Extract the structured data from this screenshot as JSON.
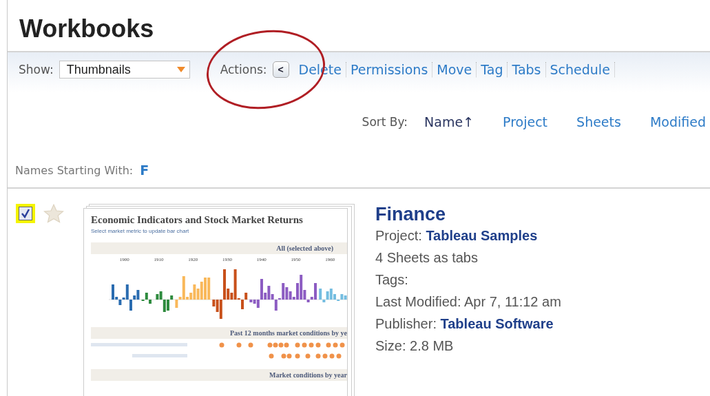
{
  "page": {
    "title": "Workbooks"
  },
  "toolbar": {
    "show_label": "Show:",
    "show_value": "Thumbnails",
    "actions_label": "Actions:",
    "collapse_button": "<",
    "actions": [
      "Delete",
      "Permissions",
      "Move",
      "Tag",
      "Tabs",
      "Schedule"
    ]
  },
  "sort": {
    "label": "Sort By:",
    "options": [
      {
        "label": "Name",
        "selected": true,
        "arrow": "↑"
      },
      {
        "label": "Project",
        "selected": false
      },
      {
        "label": "Sheets",
        "selected": false
      },
      {
        "label": "Modified",
        "selected": false
      }
    ]
  },
  "filter": {
    "label": "Names Starting With:",
    "letter": "F"
  },
  "workbooks": [
    {
      "checked": true,
      "favorite": false,
      "thumbnail": {
        "title": "Economic Indicators and Stock Market Returns",
        "subtitle": "Select market metric to update bar chart",
        "section_1": "All (selected above)",
        "years": [
          "1900",
          "1910",
          "1920",
          "1930",
          "1940",
          "1950",
          "1960"
        ],
        "section_2": "Past 12 months market conditions by ye",
        "section_3": "Market conditions by year"
      },
      "name": "Finance",
      "details": [
        {
          "label": "Project:",
          "value": "Tableau Samples"
        },
        {
          "label": "4 Sheets as tabs"
        },
        {
          "label": "Tags:"
        },
        {
          "label": "Last Modified: Apr 7, 11:12 am"
        },
        {
          "label": "Publisher:",
          "value": "Tableau Software"
        },
        {
          "label": "Size: 2.8 MB"
        }
      ]
    }
  ]
}
